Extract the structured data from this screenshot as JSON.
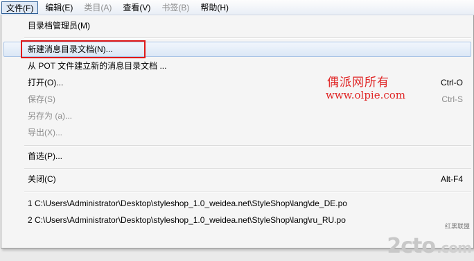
{
  "menubar": {
    "items": [
      {
        "label": "文件(F)",
        "state": "active"
      },
      {
        "label": "编辑(E)",
        "state": "normal"
      },
      {
        "label": "类目(A)",
        "state": "disabled"
      },
      {
        "label": "查看(V)",
        "state": "normal"
      },
      {
        "label": "书签(B)",
        "state": "disabled"
      },
      {
        "label": "帮助(H)",
        "state": "normal"
      }
    ]
  },
  "file_menu": {
    "catalog_manager": "目录档管理员(M)",
    "new_catalog": "新建消息目录文档(N)...",
    "new_from_pot": "从 POT 文件建立新的消息目录文档 ...",
    "open": {
      "label": "打开(O)...",
      "shortcut": "Ctrl-O"
    },
    "save": {
      "label": "保存(S)",
      "shortcut": "Ctrl-S"
    },
    "save_as": "另存为 (a)...",
    "export": "导出(X)...",
    "preferences": "首选(P)...",
    "close": {
      "label": "关闭(C)",
      "shortcut": "Alt-F4"
    },
    "recent": [
      "1 C:\\Users\\Administrator\\Desktop\\styleshop_1.0_weidea.net\\StyleShop\\lang\\de_DE.po",
      "2 C:\\Users\\Administrator\\Desktop\\styleshop_1.0_weidea.net\\StyleShop\\lang\\ru_RU.po"
    ]
  },
  "watermark": {
    "chinese": "偶派网所有",
    "url": "www.olpie.com"
  },
  "logo": {
    "brand": "2cto",
    "suffix": ".com",
    "tagline": "红黑联盟"
  },
  "colors": {
    "highlight_border": "#e01818",
    "watermark": "#e02525"
  }
}
